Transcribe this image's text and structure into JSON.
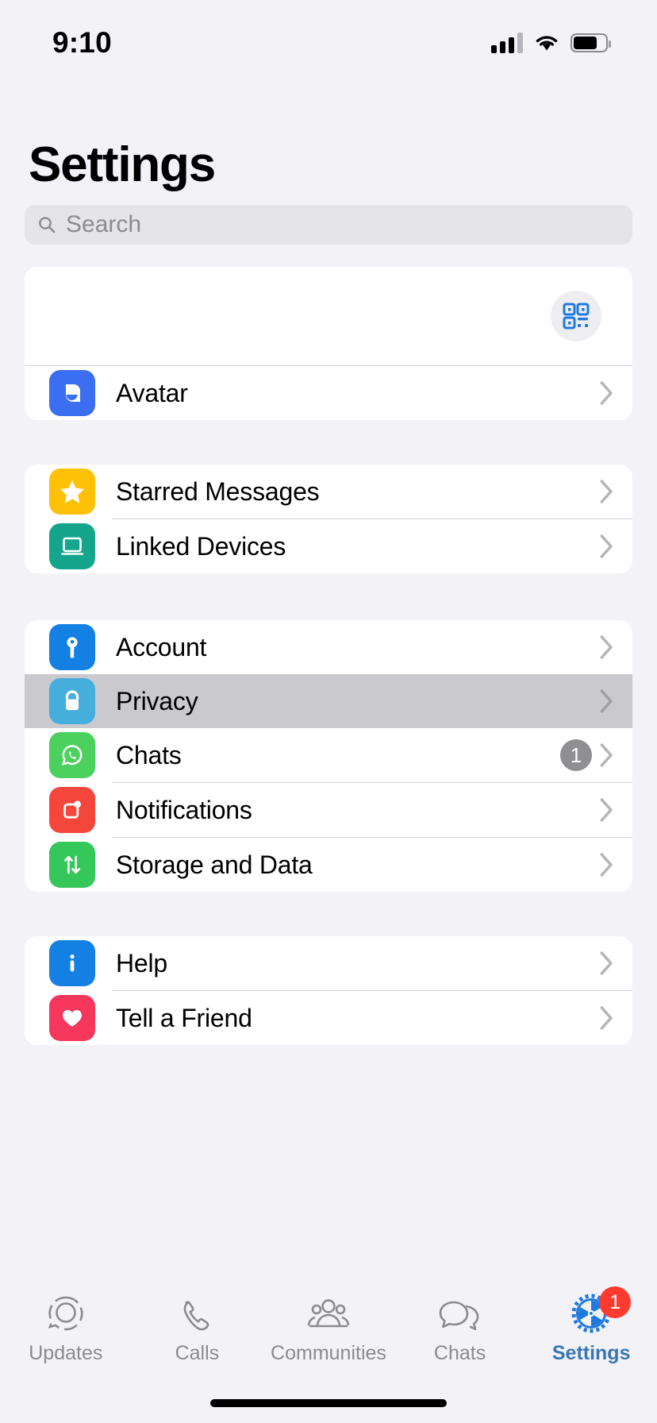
{
  "status_bar": {
    "time": "9:10",
    "signal_icon": "signal-bars-icon",
    "wifi_icon": "wifi-icon",
    "battery_icon": "battery-icon"
  },
  "header": {
    "title": "Settings"
  },
  "search": {
    "placeholder": "Search",
    "icon": "search-icon"
  },
  "profile_card": {
    "qr_button_label": "qr-code-icon"
  },
  "colors": {
    "page_background": "#f2f2f7",
    "card_background": "#ffffff",
    "pressed_row": "#c9c9ce",
    "accent_blue": "#1f7ae0",
    "tab_active": "#3a76b5",
    "tab_inactive": "#8a8a8f",
    "badge_gray": "#8e8e93",
    "badge_red": "#ff3b30"
  },
  "groups": [
    {
      "name": "avatar-group",
      "rows": [
        {
          "label": "Avatar",
          "icon": "avatar-icon",
          "icon_color": "#3b6ef0",
          "badge": null
        }
      ]
    },
    {
      "name": "messages-group",
      "rows": [
        {
          "label": "Starred Messages",
          "icon": "star-icon",
          "icon_color": "#ffc107",
          "badge": null
        },
        {
          "label": "Linked Devices",
          "icon": "laptop-icon",
          "icon_color": "#14a58c",
          "badge": null
        }
      ]
    },
    {
      "name": "account-group",
      "rows": [
        {
          "label": "Account",
          "icon": "key-icon",
          "icon_color": "#1580e4",
          "badge": null,
          "pressed": false
        },
        {
          "label": "Privacy",
          "icon": "lock-icon",
          "icon_color": "#45aedd",
          "badge": null,
          "pressed": true
        },
        {
          "label": "Chats",
          "icon": "whatsapp-chat-icon",
          "icon_color": "#4cd05e",
          "badge": "1",
          "pressed": false
        },
        {
          "label": "Notifications",
          "icon": "notification-bell-icon",
          "icon_color": "#f5463b",
          "badge": null,
          "pressed": false
        },
        {
          "label": "Storage and Data",
          "icon": "arrows-updown-icon",
          "icon_color": "#35c759",
          "badge": null,
          "pressed": false
        }
      ]
    },
    {
      "name": "help-group",
      "rows": [
        {
          "label": "Help",
          "icon": "info-icon",
          "icon_color": "#1580e4",
          "badge": null
        },
        {
          "label": "Tell a Friend",
          "icon": "heart-icon",
          "icon_color": "#f4375a",
          "badge": null
        }
      ]
    }
  ],
  "tabs": [
    {
      "label": "Updates",
      "icon": "status-updates-icon",
      "active": false,
      "badge": null
    },
    {
      "label": "Calls",
      "icon": "phone-icon",
      "active": false,
      "badge": null
    },
    {
      "label": "Communities",
      "icon": "communities-icon",
      "active": false,
      "badge": null
    },
    {
      "label": "Chats",
      "icon": "chat-bubbles-icon",
      "active": false,
      "badge": null
    },
    {
      "label": "Settings",
      "icon": "gear-icon",
      "active": true,
      "badge": "1"
    }
  ]
}
